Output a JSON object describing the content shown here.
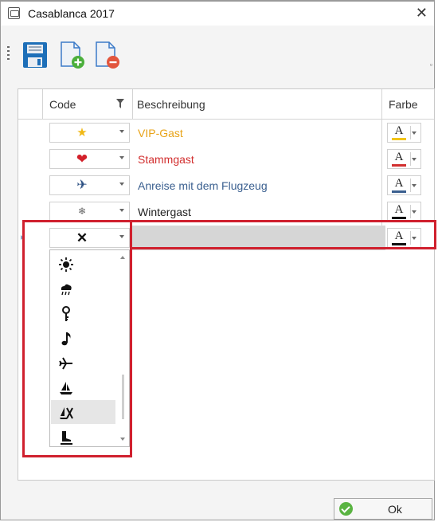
{
  "window": {
    "title": "Casablanca 2017",
    "close_symbol": "✕"
  },
  "toolbar": {
    "buttons": [
      "save-icon",
      "add-document-icon",
      "remove-document-icon"
    ],
    "overflow_symbol": "▫"
  },
  "grid": {
    "columns": {
      "code": "Code",
      "description": "Beschreibung",
      "color": "Farbe"
    },
    "rows": [
      {
        "symbol": "★",
        "icon": "star-icon",
        "description": "VIP-Gast",
        "text_color": "#e8a317",
        "color_bar": "#f2c418"
      },
      {
        "symbol": "❤",
        "icon": "heart-icon",
        "description": "Stammgast",
        "text_color": "#d22f2f",
        "color_bar": "#d22f2f"
      },
      {
        "symbol": "✈",
        "icon": "airplane-icon",
        "description": "Anreise mit dem Flugzeug",
        "text_color": "#3a5f8f",
        "color_bar": "#3a5f8f"
      },
      {
        "symbol": "❄",
        "icon": "snowflake-icon",
        "description": "Wintergast",
        "text_color": "#222222",
        "color_bar": "#111111"
      }
    ],
    "active_row": {
      "symbol": "✕",
      "icon": "cross-icon",
      "description": "",
      "color_bar": "#111111"
    },
    "color_letter": "A"
  },
  "dropdown": {
    "items": [
      "sun-icon",
      "rain-cloud-icon",
      "key-icon",
      "music-note-icon",
      "airplane-icon",
      "sailboat-icon",
      "sailboat-crossed-icon",
      "ice-skate-icon"
    ],
    "selected_index": 6
  },
  "footer": {
    "ok_label": "Ok"
  },
  "colors": {
    "highlight": "#d0202e"
  }
}
